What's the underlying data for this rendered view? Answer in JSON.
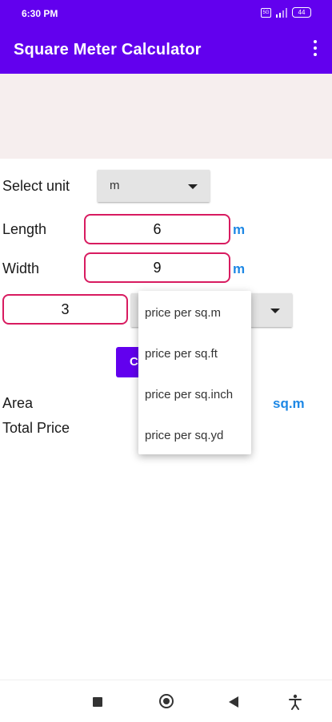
{
  "status_bar": {
    "time": "6:30 PM",
    "sim_badge": "5G",
    "battery": "44"
  },
  "app_bar": {
    "title": "Square Meter Calculator"
  },
  "form": {
    "select_unit_label": "Select unit",
    "unit_selected": "m",
    "length_label": "Length",
    "length_value": "6",
    "length_unit": "m",
    "width_label": "Width",
    "width_value": "9",
    "width_unit": "m",
    "price_value": "3",
    "calculate_label": "C"
  },
  "price_dropdown": {
    "options": [
      "price per sq.m",
      "price per sq.ft",
      "price per sq.inch",
      "price per sq.yd"
    ]
  },
  "results": {
    "area_label": "Area",
    "area_unit": "sq.m",
    "total_price_label": "Total Price"
  },
  "nav_bar": {
    "accessibility_glyph": "✝"
  }
}
